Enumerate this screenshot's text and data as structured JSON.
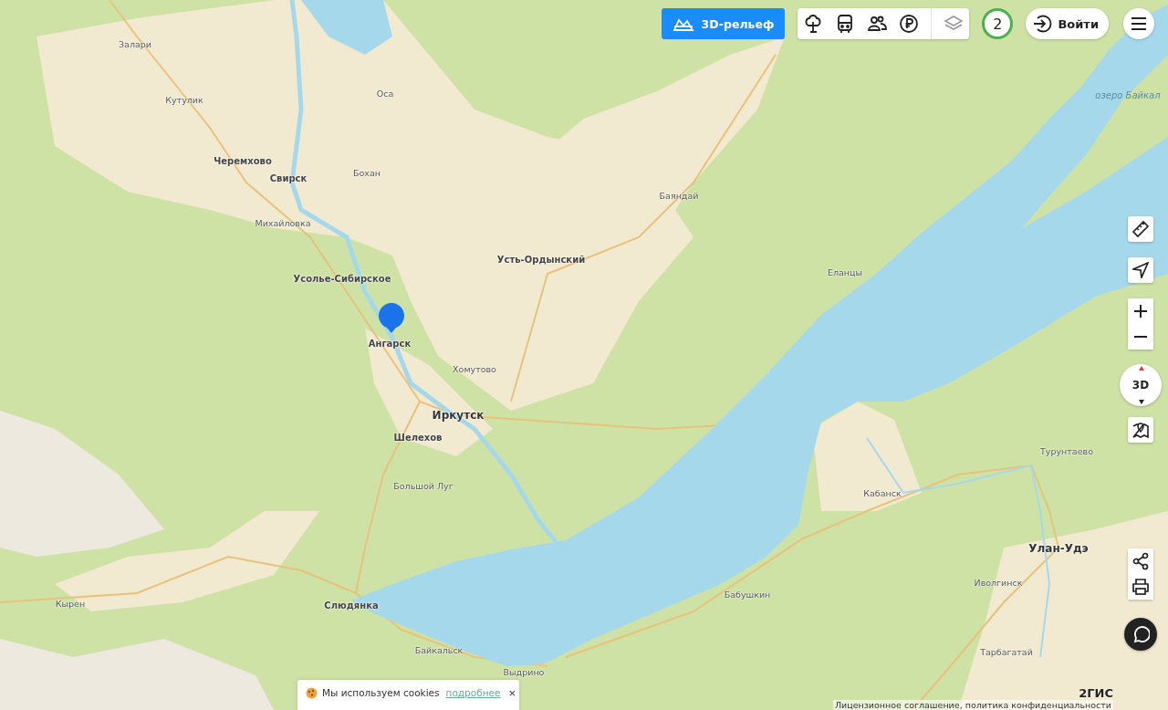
{
  "top_bar": {
    "relief_button": "3D-рельеф",
    "notification_count": "2",
    "login_button": "Войти"
  },
  "map": {
    "labels": [
      {
        "text": "Залари",
        "kind": "village"
      },
      {
        "text": "Кутулик",
        "kind": "village"
      },
      {
        "text": "Черемхово",
        "kind": "city"
      },
      {
        "text": "Свирск",
        "kind": "city"
      },
      {
        "text": "Оса",
        "kind": "village"
      },
      {
        "text": "Бохан",
        "kind": "village"
      },
      {
        "text": "Михайловка",
        "kind": "village"
      },
      {
        "text": "Усолье-Сибирское",
        "kind": "city"
      },
      {
        "text": "Ангарск",
        "kind": "city"
      },
      {
        "text": "Усть-Ордынский",
        "kind": "city"
      },
      {
        "text": "Баяндай",
        "kind": "village"
      },
      {
        "text": "Еланцы",
        "kind": "village"
      },
      {
        "text": "озеро Байкал",
        "kind": "water"
      },
      {
        "text": "Хомутово",
        "kind": "village"
      },
      {
        "text": "Иркутск",
        "kind": "capital"
      },
      {
        "text": "Шелехов",
        "kind": "city"
      },
      {
        "text": "Большой Луг",
        "kind": "village"
      },
      {
        "text": "Кырен",
        "kind": "village"
      },
      {
        "text": "Слюдянка",
        "kind": "city"
      },
      {
        "text": "Байкальск",
        "kind": "village"
      },
      {
        "text": "Выдрино",
        "kind": "village"
      },
      {
        "text": "Бабушкин",
        "kind": "village"
      },
      {
        "text": "Кабанск",
        "kind": "village"
      },
      {
        "text": "Турунтаево",
        "kind": "village"
      },
      {
        "text": "Улан-Удэ",
        "kind": "capital"
      },
      {
        "text": "Иволгинск",
        "kind": "village"
      },
      {
        "text": "Тарбагатай",
        "kind": "village"
      }
    ]
  },
  "compass": {
    "label": "3D"
  },
  "cookie_banner": {
    "text": "Мы используем cookies",
    "link": "подробнее",
    "close": "×"
  },
  "footer": {
    "logo": "2ГИС",
    "legal": "Лицензионное соглашение, политика конфиденциальности"
  }
}
